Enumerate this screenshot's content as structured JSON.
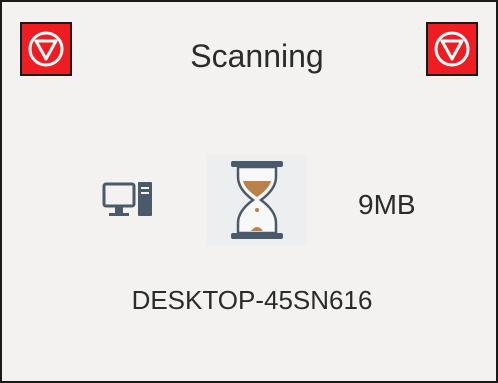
{
  "status": {
    "title": "Scanning",
    "size": "9MB",
    "hostname": "DESKTOP-45SN616"
  },
  "controls": {
    "left_stop_icon": "stop-circle-icon",
    "right_stop_icon": "stop-circle-icon"
  },
  "icons": {
    "computer": "desktop-computer-icon",
    "progress": "hourglass-icon"
  },
  "colors": {
    "stop_button": "#ef1c22",
    "hourglass_sand": "#b8824a",
    "icon_dark": "#4a5a6a",
    "panel_background": "#f3f2f1"
  }
}
